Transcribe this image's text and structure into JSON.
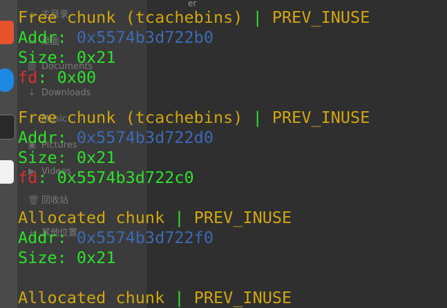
{
  "file_manager": {
    "top_text": "er",
    "places": [
      {
        "icon": "home-icon",
        "label": "主目录"
      },
      {
        "icon": "desktop-icon",
        "label": "桌面"
      },
      {
        "icon": "documents-icon",
        "label": "Documents"
      },
      {
        "icon": "downloads-icon",
        "label": "Downloads"
      },
      {
        "icon": "music-icon",
        "label": "Music"
      },
      {
        "icon": "pictures-icon",
        "label": "Pictures"
      },
      {
        "icon": "videos-icon",
        "label": "Videos"
      },
      {
        "icon": "trash-icon",
        "label": "回收站"
      },
      {
        "icon": "plus-icon",
        "label": "其他位置"
      }
    ]
  },
  "terminal": {
    "blocks": [
      {
        "kind": "free",
        "header_type": "Free chunk (tcachebins)",
        "sep": " | ",
        "flag": "PREV_INUSE",
        "addr_label": "Addr: ",
        "addr_value": "0x5574b3d722b0",
        "size_label": "Size: ",
        "size_value": "0x21",
        "fd_label": "fd",
        "fd_sep": ": ",
        "fd_value": "0x00"
      },
      {
        "kind": "free",
        "header_type": "Free chunk (tcachebins)",
        "sep": " | ",
        "flag": "PREV_INUSE",
        "addr_label": "Addr: ",
        "addr_value": "0x5574b3d722d0",
        "size_label": "Size: ",
        "size_value": "0x21",
        "fd_label": "fd",
        "fd_sep": ": ",
        "fd_value": "0x5574b3d722c0"
      },
      {
        "kind": "allocated",
        "header_type": "Allocated chunk",
        "sep": " | ",
        "flag": "PREV_INUSE",
        "addr_label": "Addr: ",
        "addr_value": "0x5574b3d722f0",
        "size_label": "Size: ",
        "size_value": "0x21"
      },
      {
        "kind": "allocated",
        "header_type": "Allocated chunk",
        "sep": " | ",
        "flag": "PREV_INUSE"
      }
    ]
  }
}
